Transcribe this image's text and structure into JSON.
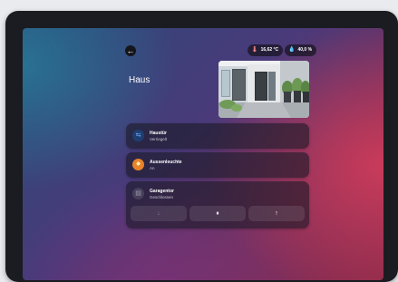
{
  "header": {
    "back_icon": "arrow-left-icon",
    "temperature": "16,62 °C",
    "temperature_icon": "thermometer-icon",
    "humidity": "40,0 %",
    "humidity_icon": "droplet-icon"
  },
  "page": {
    "title": "Haus"
  },
  "camera": {
    "icon": "door-camera-image"
  },
  "devices": [
    {
      "name": "Haustür",
      "state": "Verriegelt",
      "icon": "door-lock-icon",
      "color": "#7fb0ff"
    },
    {
      "name": "Aussenleuchte",
      "state": "An",
      "icon": "light-bulb-icon",
      "color": "#e7832a"
    },
    {
      "name": "Garagentor",
      "state": "Geschlossen",
      "icon": "garage-icon",
      "color": "#9aa0b0"
    }
  ],
  "garage_controls": {
    "down": "↓",
    "pause": "⏸",
    "up": "↑"
  }
}
